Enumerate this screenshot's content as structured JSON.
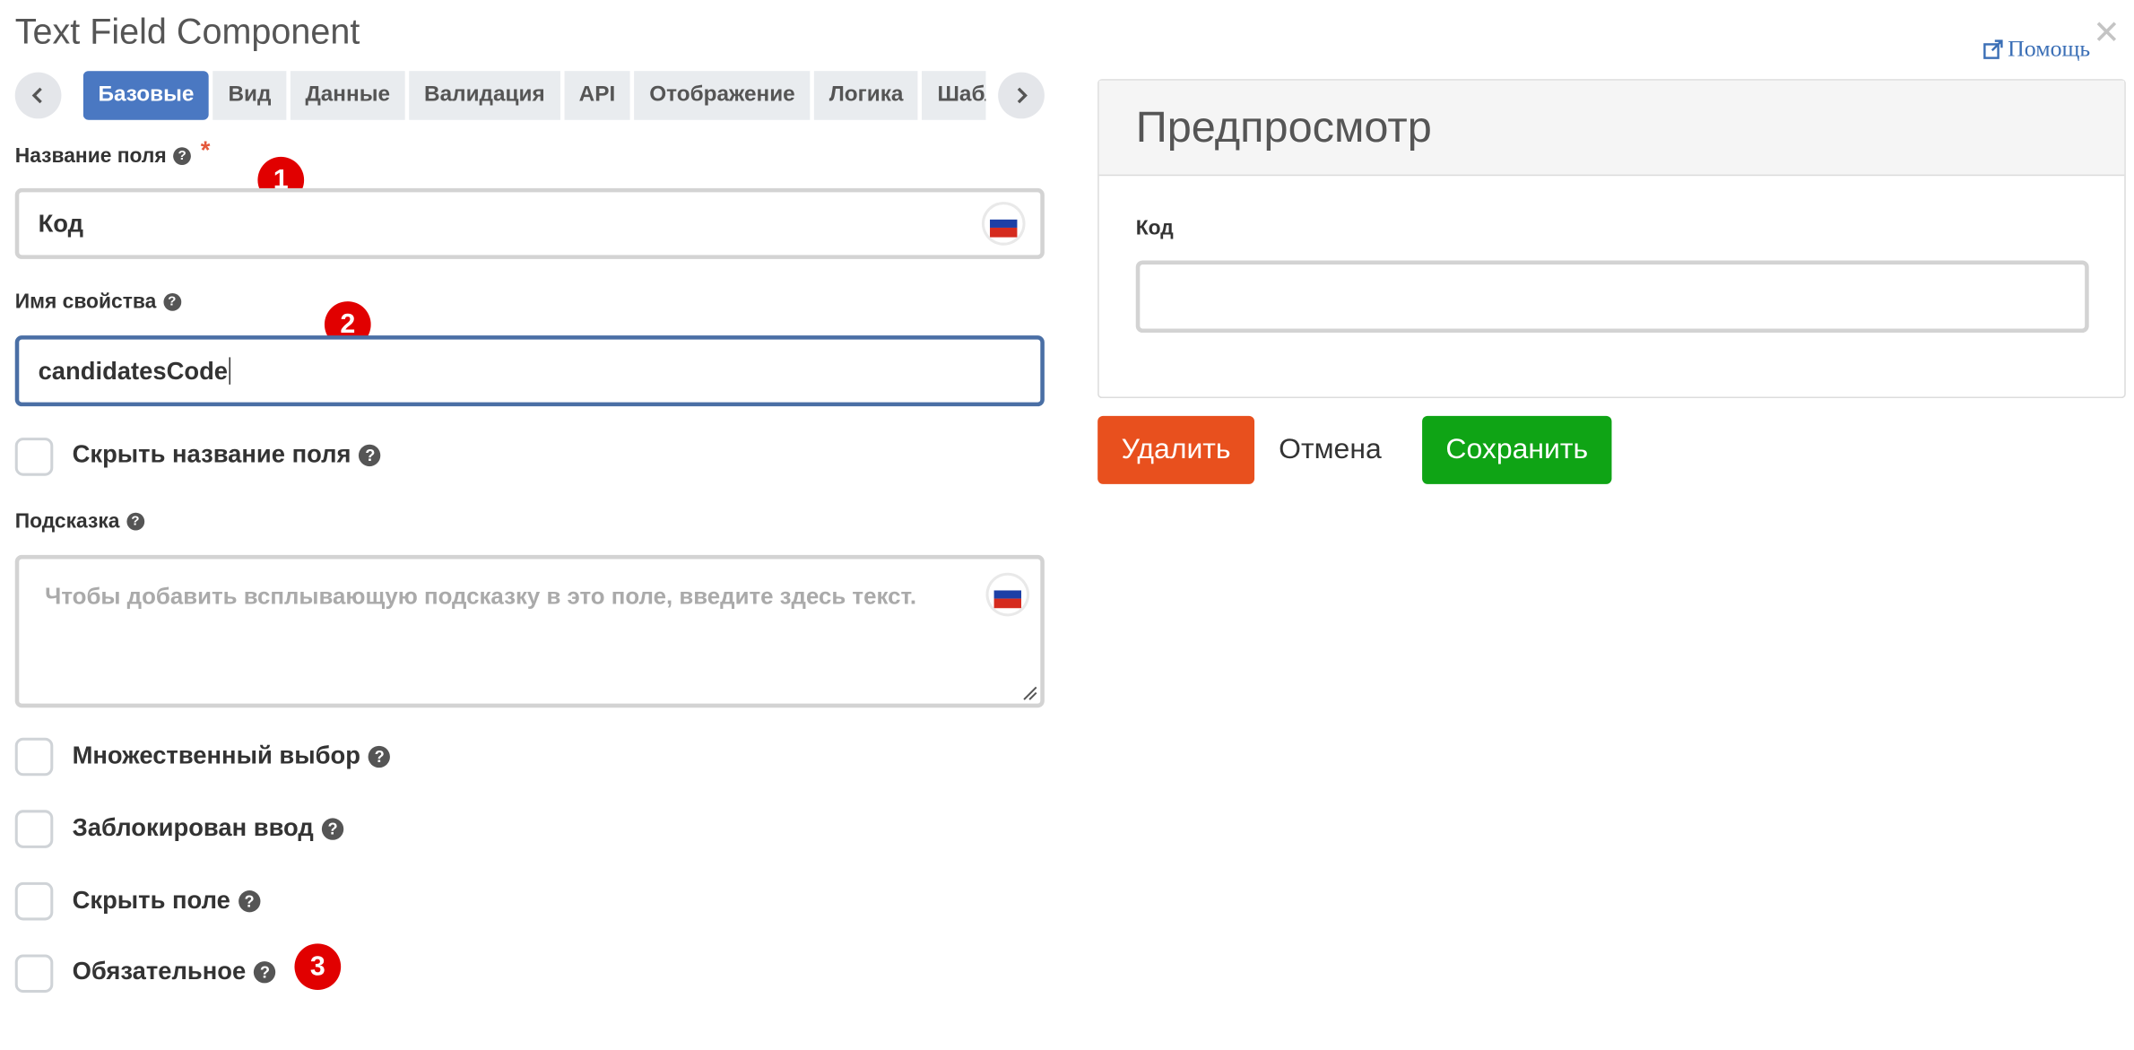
{
  "dialog": {
    "title": "Text Field Component",
    "help_label": "Помощь",
    "close_glyph": "✕"
  },
  "tabs": [
    {
      "label": "Базовые",
      "active": true
    },
    {
      "label": "Вид",
      "active": false
    },
    {
      "label": "Данные",
      "active": false
    },
    {
      "label": "Валидация",
      "active": false
    },
    {
      "label": "API",
      "active": false
    },
    {
      "label": "Отображение",
      "active": false
    },
    {
      "label": "Логика",
      "active": false
    },
    {
      "label": "Шаблон",
      "active": false
    }
  ],
  "form": {
    "field_name": {
      "label": "Название поля",
      "required_mark": "*",
      "value": "Код",
      "badge": "1"
    },
    "property_name": {
      "label": "Имя свойства",
      "value": "candidatesCode",
      "badge": "2"
    },
    "hide_label": {
      "label": "Скрыть название поля",
      "checked": false
    },
    "tooltip": {
      "label": "Подсказка",
      "placeholder": "Чтобы добавить всплывающую подсказку в это поле, введите здесь текст."
    },
    "multiple": {
      "label": "Множественный выбор",
      "checked": false
    },
    "disabled": {
      "label": "Заблокирован ввод",
      "checked": false
    },
    "hidden": {
      "label": "Скрыть поле",
      "checked": false
    },
    "required": {
      "label": "Обязательное",
      "checked": false,
      "badge": "3"
    }
  },
  "preview": {
    "title": "Предпросмотр",
    "field_label": "Код",
    "field_value": ""
  },
  "buttons": {
    "delete": "Удалить",
    "cancel": "Отмена",
    "save": "Сохранить"
  },
  "colors": {
    "active_tab": "#4a78c2",
    "delete": "#e8501e",
    "save": "#0fa415",
    "badge": "#e10000",
    "help_link": "#3b6fb6"
  },
  "icons": {
    "language_flag": "russia-flag-icon",
    "help": "question-circle-icon"
  }
}
